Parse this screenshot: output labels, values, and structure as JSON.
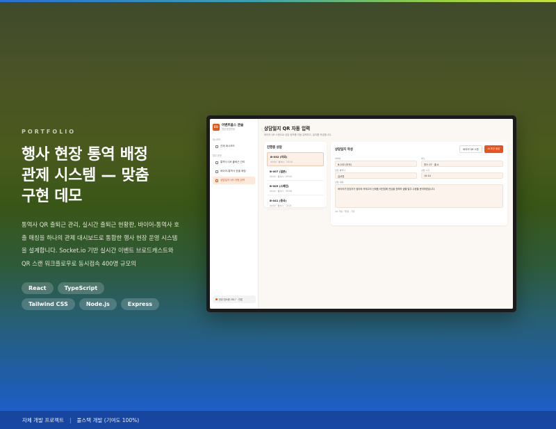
{
  "hero": {
    "eyebrow": "PORTFOLIO",
    "title_line1": "행사 현장 통역 배정",
    "title_line2": "관제 시스템 — 맞춤",
    "title_line3": "구현 데모",
    "description": "통역사 QR 출퇴근 관리, 실시간 출퇴근 현황판, 바이어-통역사 호출 매칭을 하나의 관제 대시보드로 통합한 행사 현장 운영 시스템을 설계합니다. Socket.io 기반 실시간 이벤트 브로드캐스트와 QR 스캔 워크플로우로 동시접속 400명 규모의",
    "tags": [
      "React",
      "TypeScript",
      "Tailwind CSS",
      "Node.js",
      "Express"
    ]
  },
  "footer": {
    "left": "자체 개발 프로젝트",
    "right": "풀스택 개발 (기여도 100%)"
  },
  "app": {
    "brand_badge": "EO",
    "brand_name": "이벤트옵스 관술",
    "brand_sub": "현장 운영관제",
    "nav_group1": "대시보드",
    "nav_group2": "업무 운영",
    "nav": [
      "관제 대시보드",
      "통역사 QR 출퇴근 관리",
      "바이어-통역사 호출 매칭",
      "상담일지 QR 자동 입력"
    ],
    "status": "현장 접속중 2817 · 연결",
    "page_title": "상담일지 QR 자동 입력",
    "page_sub": "바이어 QR 스캔으로 상담 정보를 자동 입력하고, 일지를 작성합니다.",
    "list_title": "진행중 상담",
    "list": [
      {
        "code": "B-032 (미국)",
        "meta": "바이어 · 통역사 · 10:14"
      },
      {
        "code": "B-007 (일본)",
        "meta": "바이어 · 통역사 · 09:44"
      },
      {
        "code": "B-009 (스페인)",
        "meta": "바이어 · 통역사 · 09:58"
      },
      {
        "code": "B-041 (중국)",
        "meta": "바이어 · 통역사 · 10:21"
      }
    ],
    "form_title": "상담일지 작성",
    "btn_scan": "바이어 QR 스캔",
    "btn_ai": "AI 초안 생성",
    "buyer_label": "바이어",
    "buyer_value": "B-032 (미국)",
    "booth_label": "부스",
    "booth_value": "부스 07 · 홀 A",
    "interp_label": "담당 통역사",
    "interp_value": "김서연",
    "time_label": "상담 시각",
    "time_value": "10:14",
    "content_label": "상담 내용",
    "content_value": "바이어가 담당자가 홀더와 카테고리 신제품 라인업에 관심을 표하며 샘플 발주 수량을 문의하였습니다.",
    "note": "QR 자동 기입됨 · 저장"
  }
}
